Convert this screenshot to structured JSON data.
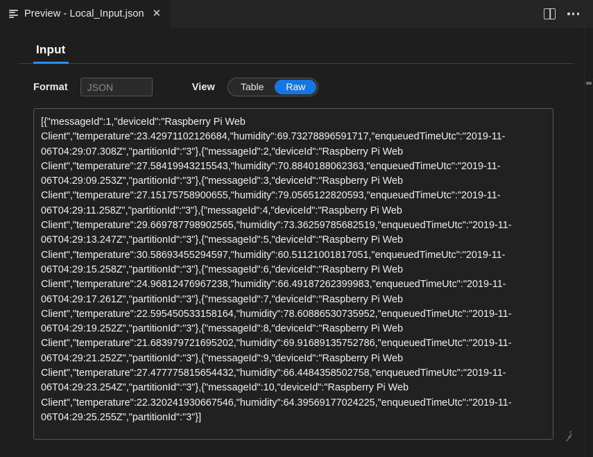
{
  "window": {
    "tab": {
      "icon": "preview-lines-icon",
      "title": "Preview - Local_Input.json",
      "close_label": "✕"
    },
    "actions": {
      "split_editor": "split-editor-icon",
      "more_actions": "more-actions-icon"
    }
  },
  "panel": {
    "tabs": [
      {
        "label": "Input",
        "active": true
      }
    ]
  },
  "controls": {
    "format_label": "Format",
    "format_value": "",
    "format_placeholder": "JSON",
    "view_label": "View",
    "view_options": [
      {
        "label": "Table",
        "active": false
      },
      {
        "label": "Raw",
        "active": true
      }
    ]
  },
  "colors": {
    "accent_blue": "#1675e0",
    "tab_underline": "#2f8ef4",
    "editor_background": "#1e1e1e",
    "textarea_background": "#212121",
    "text": "#efefef"
  },
  "raw": {
    "text": "[{\"messageId\":1,\"deviceId\":\"Raspberry Pi Web Client\",\"temperature\":23.42971102126684,\"humidity\":69.73278896591717,\"enqueuedTimeUtc\":\"2019-11-06T04:29:07.308Z\",\"partitionId\":\"3\"},{\"messageId\":2,\"deviceId\":\"Raspberry Pi Web Client\",\"temperature\":27.58419943215543,\"humidity\":70.8840188062363,\"enqueuedTimeUtc\":\"2019-11-06T04:29:09.253Z\",\"partitionId\":\"3\"},{\"messageId\":3,\"deviceId\":\"Raspberry Pi Web Client\",\"temperature\":27.15175758900655,\"humidity\":79.0565122820593,\"enqueuedTimeUtc\":\"2019-11-06T04:29:11.258Z\",\"partitionId\":\"3\"},{\"messageId\":4,\"deviceId\":\"Raspberry Pi Web Client\",\"temperature\":29.669787798902565,\"humidity\":73.36259785682519,\"enqueuedTimeUtc\":\"2019-11-06T04:29:13.247Z\",\"partitionId\":\"3\"},{\"messageId\":5,\"deviceId\":\"Raspberry Pi Web Client\",\"temperature\":30.58693455294597,\"humidity\":60.51121001817051,\"enqueuedTimeUtc\":\"2019-11-06T04:29:15.258Z\",\"partitionId\":\"3\"},{\"messageId\":6,\"deviceId\":\"Raspberry Pi Web Client\",\"temperature\":24.96812476967238,\"humidity\":66.49187262399983,\"enqueuedTimeUtc\":\"2019-11-06T04:29:17.261Z\",\"partitionId\":\"3\"},{\"messageId\":7,\"deviceId\":\"Raspberry Pi Web Client\",\"temperature\":22.595450533158164,\"humidity\":78.60886530735952,\"enqueuedTimeUtc\":\"2019-11-06T04:29:19.252Z\",\"partitionId\":\"3\"},{\"messageId\":8,\"deviceId\":\"Raspberry Pi Web Client\",\"temperature\":21.683979721695202,\"humidity\":69.91689135752786,\"enqueuedTimeUtc\":\"2019-11-06T04:29:21.252Z\",\"partitionId\":\"3\"},{\"messageId\":9,\"deviceId\":\"Raspberry Pi Web Client\",\"temperature\":27.477775815654432,\"humidity\":66.4484358502758,\"enqueuedTimeUtc\":\"2019-11-06T04:29:23.254Z\",\"partitionId\":\"3\"},{\"messageId\":10,\"deviceId\":\"Raspberry Pi Web Client\",\"temperature\":22.320241930667546,\"humidity\":64.39569177024225,\"enqueuedTimeUtc\":\"2019-11-06T04:29:25.255Z\",\"partitionId\":\"3\"}]"
  }
}
